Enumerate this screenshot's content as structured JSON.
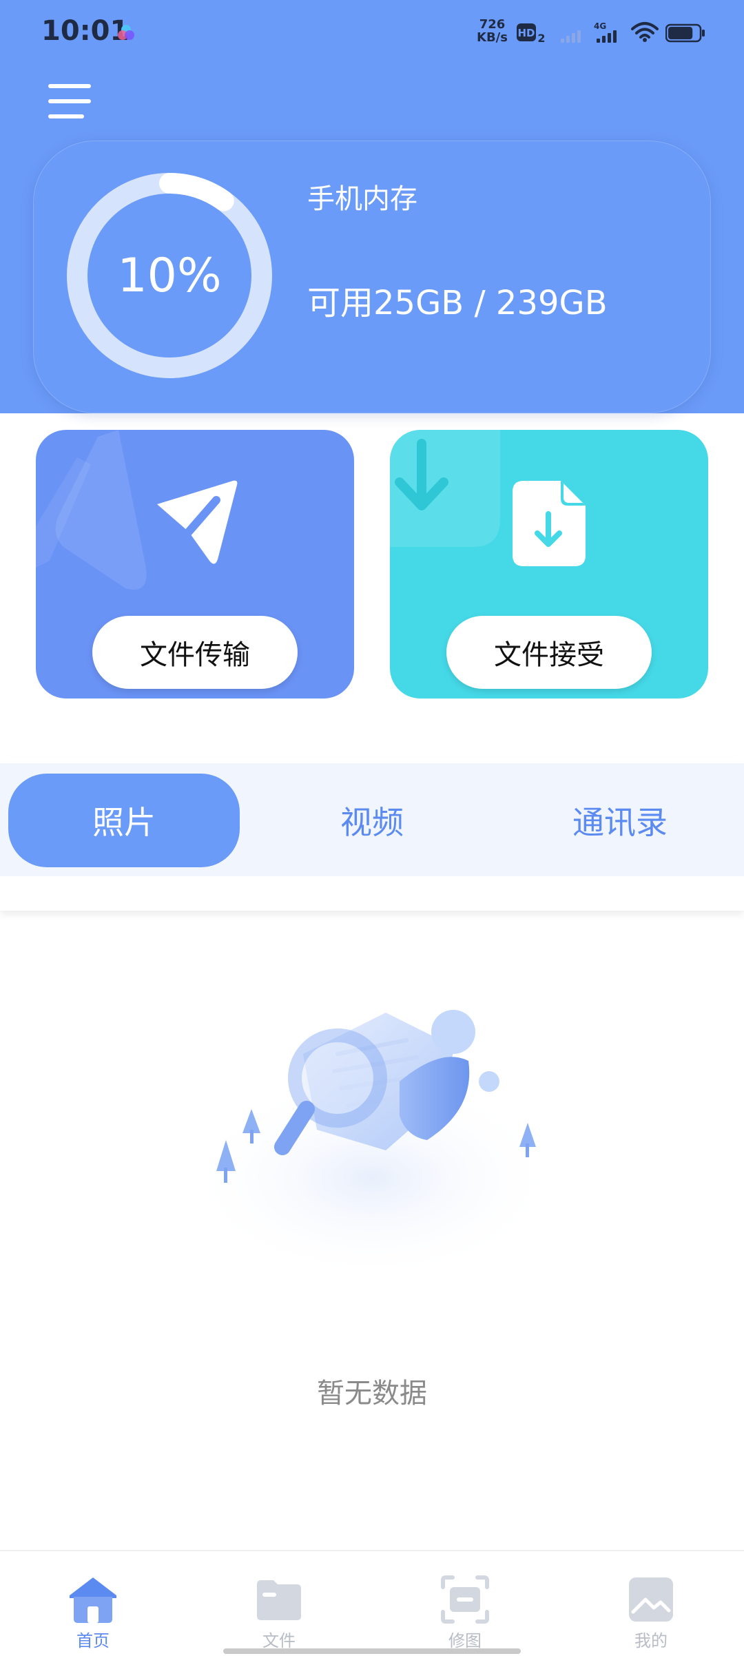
{
  "status_bar": {
    "time": "10:01",
    "net_speed_value": "726",
    "net_speed_unit": "KB/s",
    "hd_label": "HD",
    "hd_sub": "2",
    "network_type": "4G",
    "battery_level": 0.8
  },
  "storage": {
    "percent_label": "10%",
    "percent_value": 0.1,
    "title": "手机内存",
    "detail": "可用25GB / 239GB"
  },
  "actions": {
    "send_label": "文件传输",
    "receive_label": "文件接受"
  },
  "tabs": [
    {
      "label": "照片",
      "active": true
    },
    {
      "label": "视频",
      "active": false
    },
    {
      "label": "通讯录",
      "active": false
    }
  ],
  "empty_state": {
    "text": "暂无数据"
  },
  "bottom_nav": [
    {
      "label": "首页",
      "icon": "home-icon",
      "active": true
    },
    {
      "label": "文件",
      "icon": "folder-icon",
      "active": false
    },
    {
      "label": "修图",
      "icon": "edit-photo-icon",
      "active": false
    },
    {
      "label": "我的",
      "icon": "image-icon",
      "active": false
    }
  ],
  "colors": {
    "primary": "#6B9BF8",
    "cyan": "#45D9E8",
    "tab_bg": "#F1F5FD",
    "nav_active": "#5B8AF0",
    "nav_inactive": "#B8BCC6"
  }
}
